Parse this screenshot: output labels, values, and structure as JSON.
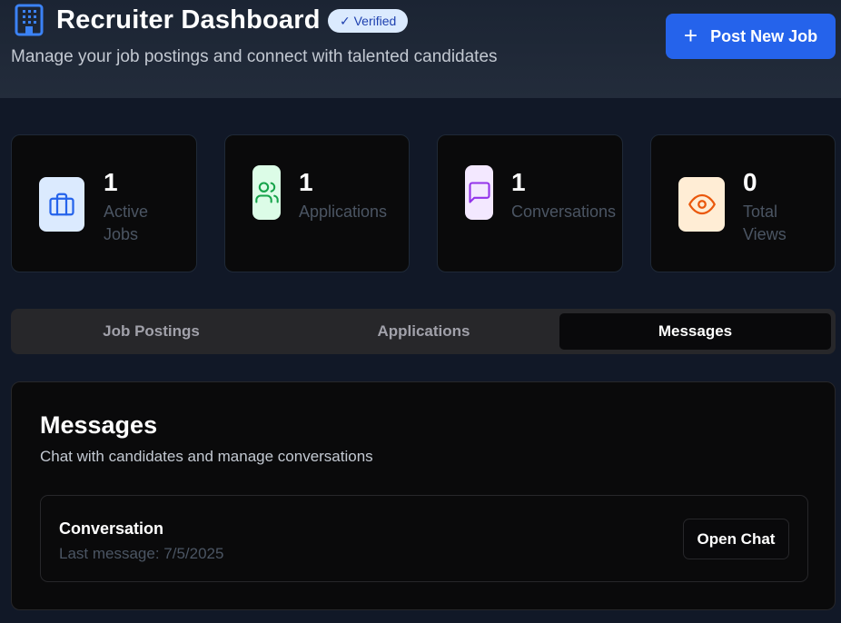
{
  "header": {
    "title": "Recruiter Dashboard",
    "verified_badge": "✓ Verified",
    "subtitle": "Manage your job postings and connect with talented candidates",
    "post_job_label": "Post New Job",
    "post_job_icon": "plus-icon",
    "brand_icon": "building-icon"
  },
  "stats": [
    {
      "value": "1",
      "label_line1": "Active",
      "label_line2": "Jobs",
      "icon": "briefcase-icon",
      "icon_color": "#2563eb",
      "icon_bg": "#dbeafe"
    },
    {
      "value": "1",
      "label_line1": "Applications",
      "label_line2": "",
      "icon": "users-icon",
      "icon_color": "#16a34a",
      "icon_bg": "#dcfce7"
    },
    {
      "value": "1",
      "label_line1": "Conversations",
      "label_line2": "",
      "icon": "message-square-icon",
      "icon_color": "#9333ea",
      "icon_bg": "#f3e8ff"
    },
    {
      "value": "0",
      "label_line1": "Total",
      "label_line2": "Views",
      "icon": "eye-icon",
      "icon_color": "#ea580c",
      "icon_bg": "#ffedd5"
    }
  ],
  "tabs": [
    {
      "label": "Job Postings",
      "active": false
    },
    {
      "label": "Applications",
      "active": false
    },
    {
      "label": "Messages",
      "active": true
    }
  ],
  "messages_panel": {
    "title": "Messages",
    "subtitle": "Chat with candidates and manage conversations",
    "conversations": [
      {
        "title": "Conversation",
        "last_message": "Last message: 7/5/2025",
        "action_label": "Open Chat"
      }
    ]
  },
  "colors": {
    "accent": "#2563eb",
    "page_bg": "#111827",
    "card_bg": "#0a0a0b"
  }
}
